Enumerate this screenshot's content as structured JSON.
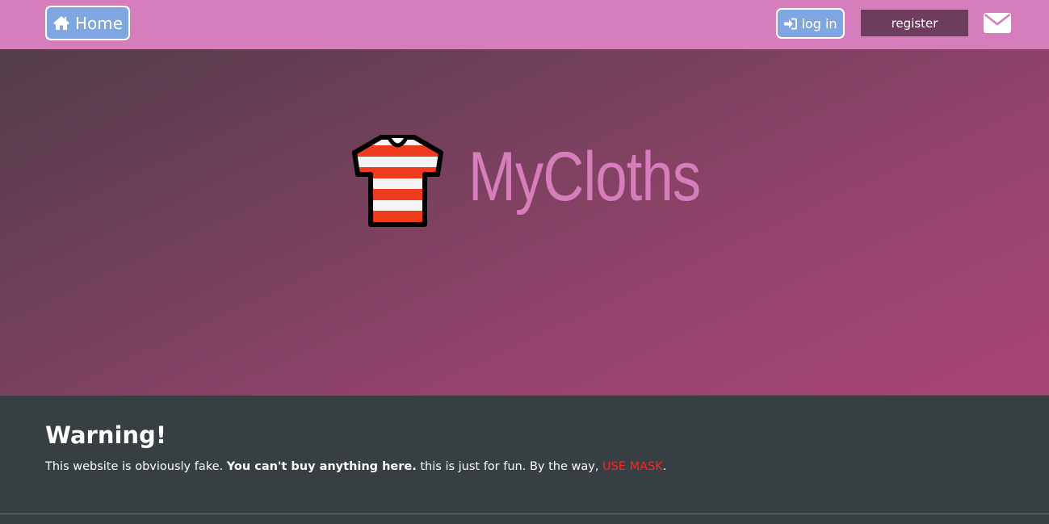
{
  "nav": {
    "home_label": "Home",
    "home_icon": "home-icon",
    "login_label": "log in",
    "login_icon": "sign-in-icon",
    "register_label": "register",
    "mail_icon": "envelope-icon"
  },
  "hero": {
    "brand": "MyCloths",
    "logo_icon": "t-shirt-icon"
  },
  "warning": {
    "title": "Warning!",
    "text_1": "This website is obviously fake. ",
    "text_bold": "You can't buy anything here.",
    "text_2": " this is just for fun. By the way, ",
    "text_highlight": "USE MASK",
    "text_end": "."
  },
  "colors": {
    "navbar": "#d67dbb",
    "button_blue": "#7fa6e0",
    "register": "#6e3d5e",
    "hero_start": "#523d49",
    "hero_end": "#a84574",
    "footer": "#373f42",
    "highlight": "#ff2525"
  }
}
